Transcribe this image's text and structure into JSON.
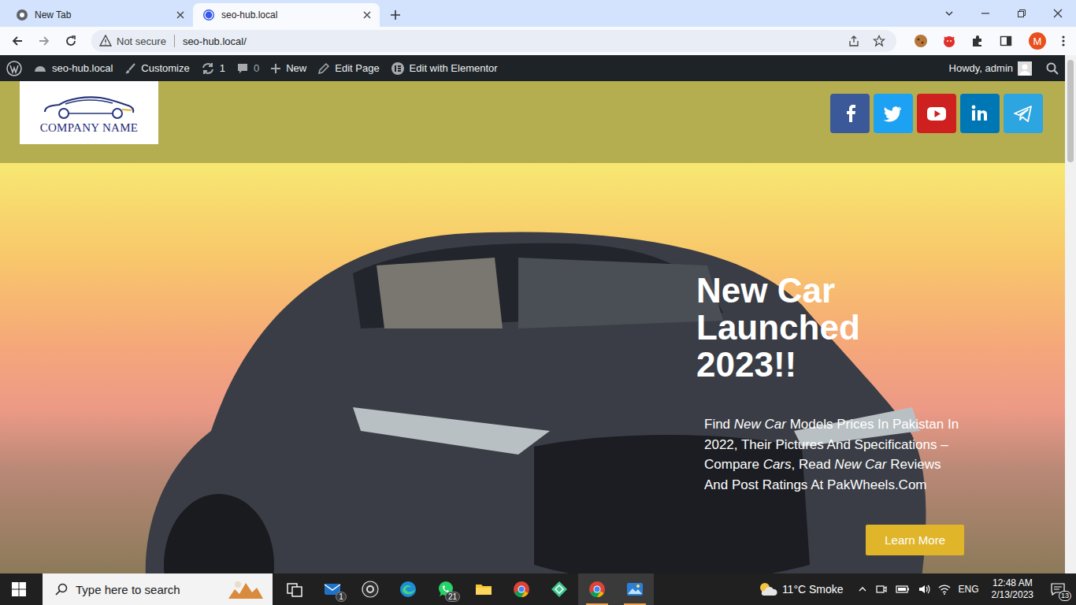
{
  "browser": {
    "tabs": [
      {
        "label": "New Tab",
        "selected": false
      },
      {
        "label": "seo-hub.local",
        "selected": true
      }
    ]
  },
  "address_bar": {
    "security": "Not secure",
    "url": "seo-hub.local/",
    "profile": "M"
  },
  "admin_bar": {
    "site": "seo-hub.local",
    "customize": "Customize",
    "updates": "1",
    "comments": "0",
    "new": "New",
    "edit_page": "Edit Page",
    "elementor": "Edit with Elementor",
    "greeting": "Howdy, admin"
  },
  "header": {
    "logo_text": "COMPANY NAME",
    "social": [
      {
        "kind": "facebook",
        "color": "#3b5998"
      },
      {
        "kind": "twitter",
        "color": "#1da1f2"
      },
      {
        "kind": "youtube",
        "color": "#cd201f"
      },
      {
        "kind": "linkedin",
        "color": "#0077b5"
      },
      {
        "kind": "telegram",
        "color": "#2ca5e0"
      }
    ]
  },
  "hero": {
    "title": "New Car Launched 2023!!",
    "paragraph": [
      {
        "text": "Find ",
        "italic": false
      },
      {
        "text": "New Car",
        "italic": true
      },
      {
        "text": " Models Prices In Pakistan In 2022, Their Pictures And Specifications – Compare ",
        "italic": false
      },
      {
        "text": "Cars",
        "italic": true
      },
      {
        "text": ", Read ",
        "italic": false
      },
      {
        "text": "New Car",
        "italic": true
      },
      {
        "text": " Reviews And Post Ratings At PakWheels.Com",
        "italic": false
      }
    ],
    "button": "Learn More"
  },
  "taskbar": {
    "search_placeholder": "Type here to search",
    "apps": [
      {
        "kind": "taskview",
        "badge": "",
        "active": false
      },
      {
        "kind": "mail",
        "badge": "1",
        "active": false
      },
      {
        "kind": "obs",
        "badge": "",
        "active": false
      },
      {
        "kind": "edge",
        "badge": "",
        "active": false
      },
      {
        "kind": "whatsapp",
        "badge": "21",
        "active": false
      },
      {
        "kind": "files",
        "badge": "",
        "active": false
      },
      {
        "kind": "chrome",
        "badge": "",
        "active": false
      },
      {
        "kind": "diamond",
        "badge": "",
        "active": false
      },
      {
        "kind": "chrome",
        "badge": "",
        "active": true
      },
      {
        "kind": "photos",
        "badge": "",
        "active": true
      }
    ],
    "weather": "11°C Smoke",
    "language": "ENG",
    "time": "12:48 AM",
    "date": "2/13/2023",
    "notifications": "13"
  }
}
